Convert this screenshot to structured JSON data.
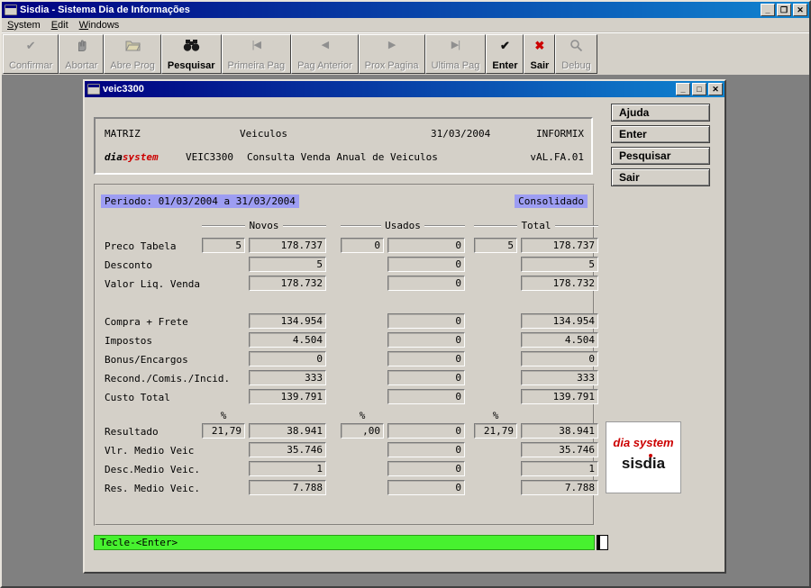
{
  "colors": {
    "face": "#d4d0c8",
    "desktop": "#808080",
    "highlight": "#9d9df2",
    "footer_green": "#47f12f",
    "brand_red": "#cc0000",
    "tb_start": "#000080",
    "tb_end": "#1084d0"
  },
  "window": {
    "title": "Sisdia - Sistema Dia de Informações"
  },
  "menu": {
    "items": [
      {
        "label": "System"
      },
      {
        "label": "Edit"
      },
      {
        "label": "Windows"
      }
    ]
  },
  "toolbar": {
    "buttons": [
      {
        "label": "Confirmar",
        "icon": "check-icon",
        "disabled": true
      },
      {
        "label": "Abortar",
        "icon": "hand-icon",
        "disabled": true
      },
      {
        "label": "Abre Prog",
        "icon": "folder-open-icon",
        "disabled": true
      },
      {
        "label": "Pesquisar",
        "icon": "binoculars-icon",
        "disabled": false
      },
      {
        "label": "Primeira Pag",
        "icon": "first-page-icon",
        "disabled": true
      },
      {
        "label": "Pag Anterior",
        "icon": "prev-page-icon",
        "disabled": true
      },
      {
        "label": "Prox Pagina",
        "icon": "next-page-icon",
        "disabled": true
      },
      {
        "label": "Ultima Pag",
        "icon": "last-page-icon",
        "disabled": true
      },
      {
        "label": "Enter",
        "icon": "check-bold-icon",
        "disabled": false
      },
      {
        "label": "Sair",
        "icon": "x-red-icon",
        "disabled": false
      },
      {
        "label": "Debug",
        "icon": "magnifier-icon",
        "disabled": true
      }
    ]
  },
  "child_window": {
    "title": "veic3300",
    "header": {
      "branch": "MATRIZ",
      "module": "Veiculos",
      "date": "31/03/2004",
      "database": "INFORMIX",
      "brand_black": "dia",
      "brand_red": "system",
      "program": "VEIC3300",
      "description": "Consulta Venda Anual de Veiculos",
      "version": "vAL.FA.01"
    },
    "side_buttons": [
      {
        "label": "Ajuda"
      },
      {
        "label": "Enter"
      },
      {
        "label": "Pesquisar"
      },
      {
        "label": "Sair"
      }
    ],
    "form": {
      "period": "Periodo: 01/03/2004 a 31/03/2004",
      "mode": "Consolidado",
      "groups": [
        "Novos",
        "Usados",
        "Total"
      ],
      "pct_symbol": "%",
      "rows": [
        {
          "label": "Preco Tabela",
          "novos_qty": "5",
          "novos": "178.737",
          "usados_qty": "0",
          "usados": "0",
          "total_qty": "5",
          "total": "178.737"
        },
        {
          "label": "Desconto",
          "novos": "5",
          "usados": "0",
          "total": "5"
        },
        {
          "label": "Valor Liq. Venda",
          "novos": "178.732",
          "usados": "0",
          "total": "178.732"
        },
        {
          "label": "Compra + Frete",
          "novos": "134.954",
          "usados": "0",
          "total": "134.954",
          "gap_before": true
        },
        {
          "label": "Impostos",
          "novos": "4.504",
          "usados": "0",
          "total": "4.504"
        },
        {
          "label": "Bonus/Encargos",
          "novos": "0",
          "usados": "0",
          "total": "0"
        },
        {
          "label": "Recond./Comis./Incid.",
          "novos": "333",
          "usados": "0",
          "total": "333"
        },
        {
          "label": "Custo Total",
          "novos": "139.791",
          "usados": "0",
          "total": "139.791"
        },
        {
          "label": "Resultado",
          "novos_qty": "21,79",
          "novos": "38.941",
          "usados_qty": ",00",
          "usados": "0",
          "total_qty": "21,79",
          "total": "38.941",
          "pct_before": true
        },
        {
          "label": "Vlr. Medio Veic",
          "novos": "35.746",
          "usados": "0",
          "total": "35.746"
        },
        {
          "label": "Desc.Medio Veic.",
          "novos": "1",
          "usados": "0",
          "total": "1"
        },
        {
          "label": "Res. Medio Veic.",
          "novos": "7.788",
          "usados": "0",
          "total": "7.788"
        }
      ]
    },
    "footer": {
      "message": "Tecle-<Enter>"
    },
    "logo": {
      "line1": "dia system",
      "line2": "sisdia"
    }
  }
}
